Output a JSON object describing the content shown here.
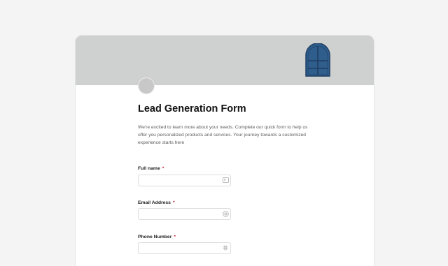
{
  "form": {
    "title": "Lead Generation Form",
    "description": "We're excited to learn more about your needs. Complete our quick form to help us offer you personalized products and services. Your journey towards a customized experience starts here",
    "required_mark": "*",
    "fields": [
      {
        "label": "Full name",
        "value": "",
        "placeholder": "",
        "icon": "contact-card-icon"
      },
      {
        "label": "Email Address",
        "value": "",
        "placeholder": "",
        "icon": "at-sign-icon"
      },
      {
        "label": "Phone Number",
        "value": "",
        "placeholder": "",
        "icon": "hash-icon"
      }
    ]
  },
  "colors": {
    "page_background": "#f4f4f4",
    "banner": "#cfd0d0",
    "window_art": "#2f5d8c",
    "required": "#d1233b"
  }
}
